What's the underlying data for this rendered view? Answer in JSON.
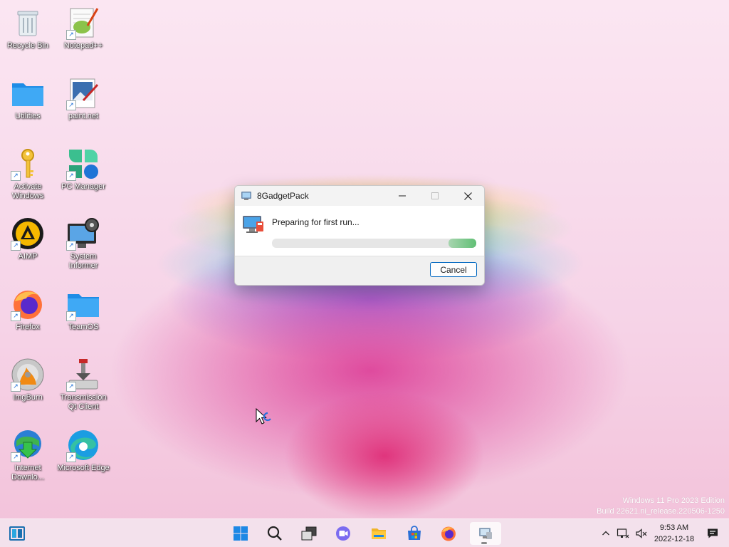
{
  "desktop": {
    "icons": [
      {
        "label": "Recycle Bin",
        "icon": "recycle-bin-icon"
      },
      {
        "label": "Notepad++",
        "icon": "notepad-plus-plus-icon"
      },
      {
        "label": "Utilities",
        "icon": "folder-icon"
      },
      {
        "label": "paint.net",
        "icon": "paint-net-icon"
      },
      {
        "label": "Activate Windows",
        "icon": "key-icon"
      },
      {
        "label": "PC Manager",
        "icon": "pc-manager-icon"
      },
      {
        "label": "AIMP",
        "icon": "aimp-icon"
      },
      {
        "label": "System Informer",
        "icon": "system-informer-icon"
      },
      {
        "label": "Firefox",
        "icon": "firefox-icon"
      },
      {
        "label": "TeamOS",
        "icon": "folder-icon"
      },
      {
        "label": "ImgBurn",
        "icon": "imgburn-icon"
      },
      {
        "label": "Transmission Qt Client",
        "icon": "transmission-icon"
      },
      {
        "label": "Internet Downlo...",
        "icon": "internet-download-manager-icon"
      },
      {
        "label": "Microsoft Edge",
        "icon": "edge-icon"
      }
    ]
  },
  "dialog": {
    "title": "8GadgetPack",
    "message": "Preparing for first run...",
    "progress_marquee": true,
    "cancel_label": "Cancel",
    "controls": {
      "minimize": "minimize-icon",
      "maximize": "maximize-icon",
      "close": "close-icon"
    }
  },
  "watermark": {
    "line1": "Windows 11 Pro 2023 Edition",
    "line2": "Build 22621.ni_release.220506-1250"
  },
  "taskbar": {
    "widgets": "widgets-icon",
    "apps": [
      "start-icon",
      "search-icon",
      "task-view-icon",
      "teams-chat-icon",
      "file-explorer-icon",
      "store-icon",
      "firefox-icon",
      "8gadgetpack-icon"
    ],
    "tray": [
      "chevron-up-icon",
      "network-icon",
      "volume-muted-icon"
    ],
    "time": "9:53 AM",
    "date": "2022-12-18",
    "notifications": "notification-icon"
  },
  "colors": {
    "accent": "#0067c0",
    "progress": "#5fbf74"
  }
}
